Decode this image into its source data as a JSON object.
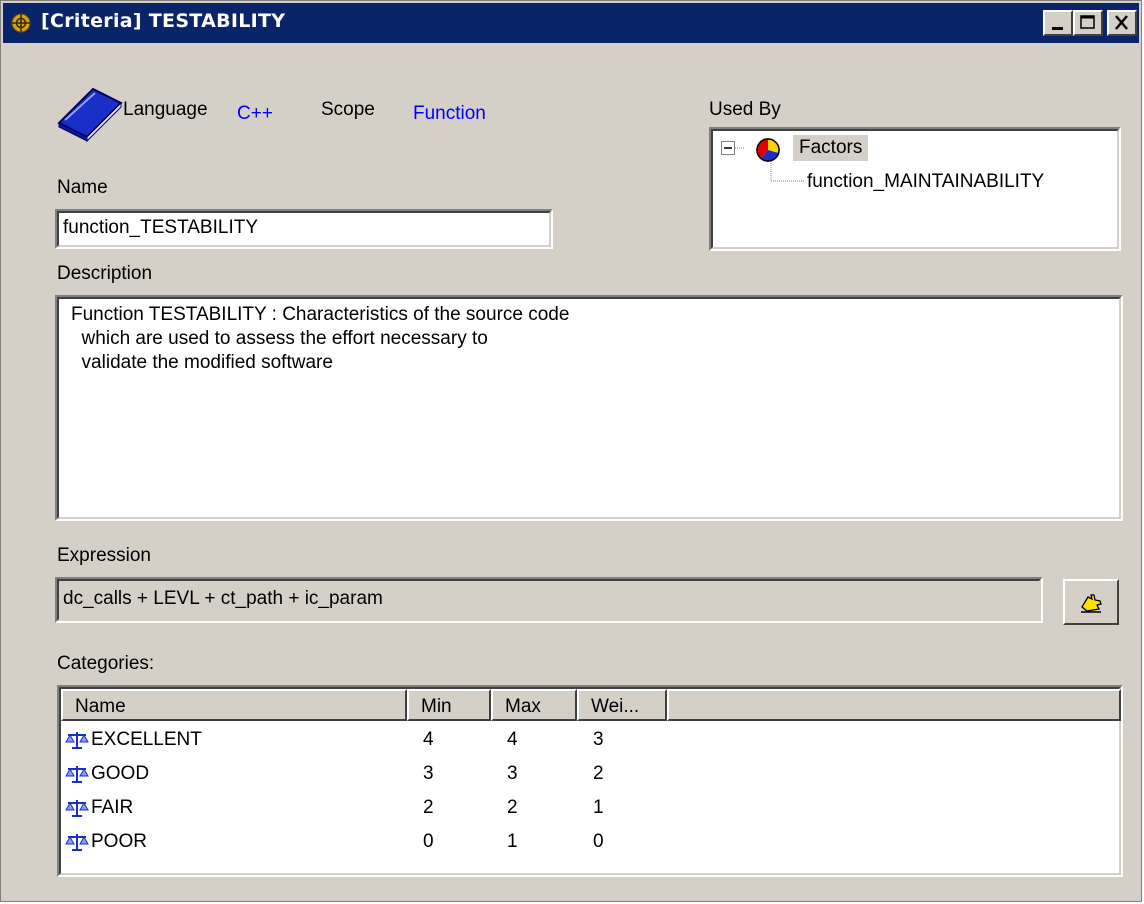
{
  "window": {
    "title": "[Criteria] TESTABILITY",
    "controls": [
      "minimize",
      "maximize",
      "close"
    ]
  },
  "header": {
    "language_label": "Language",
    "language_value": "C++",
    "scope_label": "Scope",
    "scope_value": "Function",
    "icon": "book-icon"
  },
  "used_by": {
    "label": "Used By",
    "tree": {
      "root": "Factors",
      "children": [
        "function_MAINTAINABILITY"
      ]
    }
  },
  "name": {
    "label": "Name",
    "value": "function_TESTABILITY"
  },
  "description": {
    "label": "Description",
    "lines": [
      "Function TESTABILITY : Characteristics of the source code",
      "  which are used to assess the effort necessary to",
      "  validate the modified software"
    ]
  },
  "expression": {
    "label": "Expression",
    "value": "dc_calls + LEVL + ct_path + ic_param",
    "button_icon": "pointing-hand-icon"
  },
  "categories": {
    "label": "Categories:",
    "columns": [
      "Name",
      "Min",
      "Max",
      "Wei..."
    ],
    "rows": [
      {
        "name": "EXCELLENT",
        "min": "4",
        "max": "4",
        "weight": "3"
      },
      {
        "name": "GOOD",
        "min": "3",
        "max": "3",
        "weight": "2"
      },
      {
        "name": "FAIR",
        "min": "2",
        "max": "2",
        "weight": "1"
      },
      {
        "name": "POOR",
        "min": "0",
        "max": "1",
        "weight": "0"
      }
    ]
  },
  "colors": {
    "titlebar": "#0a246a",
    "window_bg": "#d4d0c8",
    "link_blue": "#0000ff"
  }
}
